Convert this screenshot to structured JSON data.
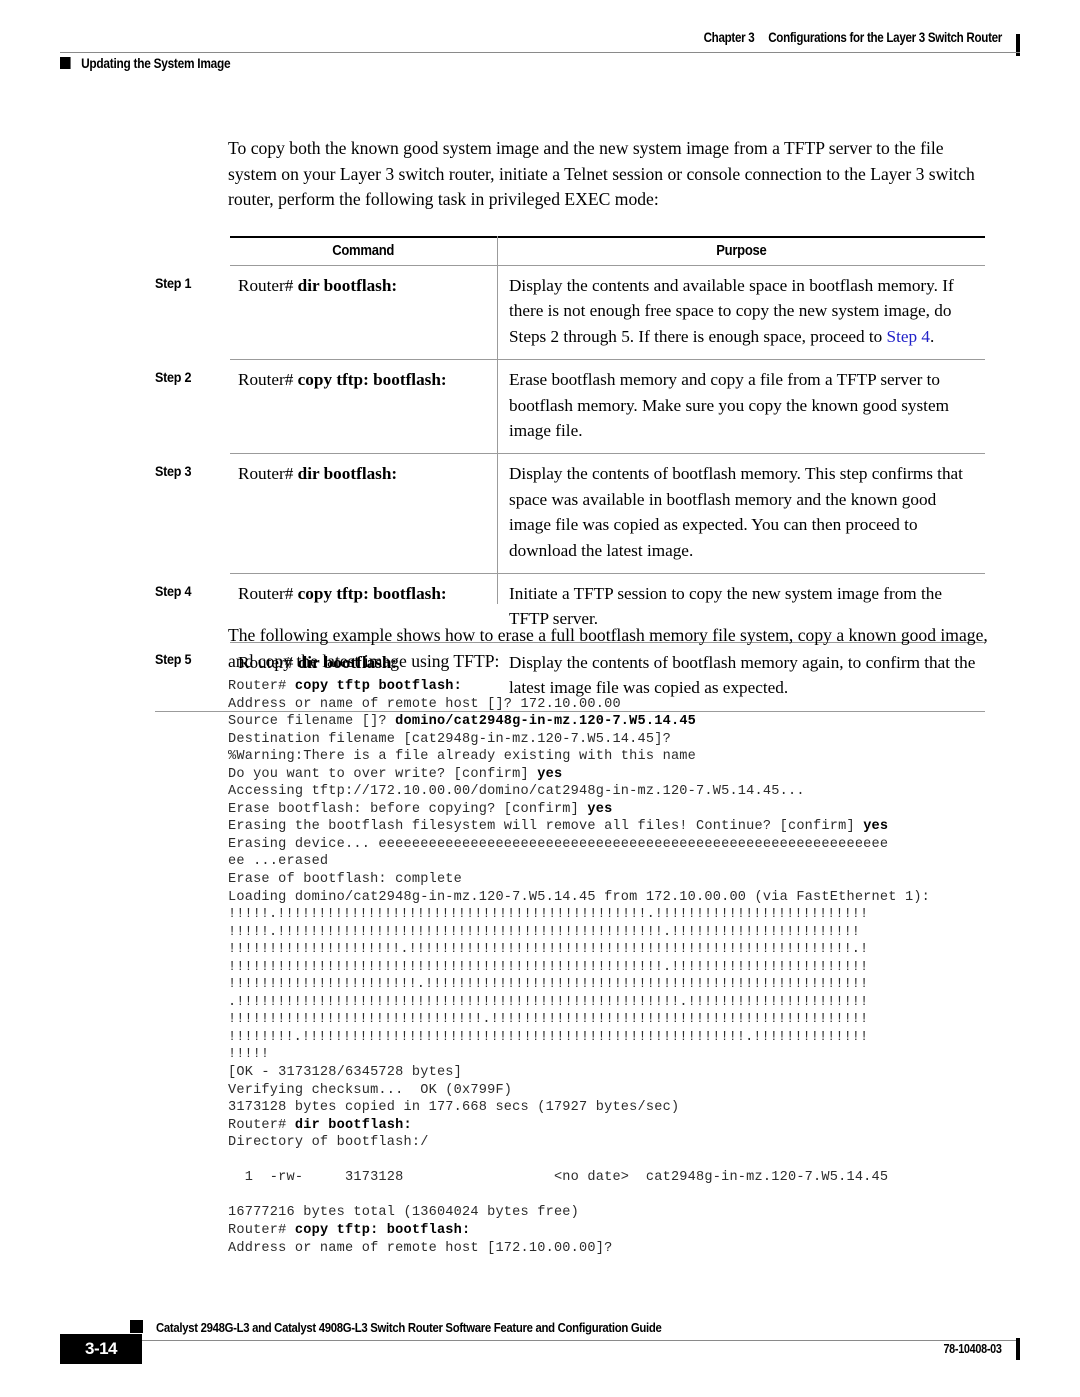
{
  "header": {
    "chapter": "Chapter 3",
    "chapter_title": "Configurations for the Layer 3 Switch Router",
    "section_title": "Updating the System Image"
  },
  "intro_paragraph": "To copy both the known good system image and the new system image from a TFTP server to the file system on your Layer 3 switch router, initiate a Telnet session or console connection to the Layer 3 switch router, perform the following task in privileged EXEC mode:",
  "table": {
    "headers": {
      "step": "",
      "command": "Command",
      "purpose": "Purpose"
    },
    "rows": [
      {
        "step": "Step 1",
        "command_prefix": "Router# ",
        "command_bold": "dir bootflash:",
        "purpose_pre": "Display the contents and available space in bootflash memory. If there is not enough free space to copy the new system image, do Steps 2 through 5. If there is enough space, proceed to ",
        "purpose_link": "Step 4",
        "purpose_post": "."
      },
      {
        "step": "Step 2",
        "command_prefix": "Router# ",
        "command_bold": "copy tftp: bootflash:",
        "purpose_pre": "Erase bootflash memory and copy a file from a TFTP server to bootflash memory. Make sure you copy the known good system image file.",
        "purpose_link": "",
        "purpose_post": ""
      },
      {
        "step": "Step 3",
        "command_prefix": "Router# ",
        "command_bold": "dir bootflash:",
        "purpose_pre": "Display the contents of bootflash memory. This step confirms that space was available in bootflash memory and the known good image file was copied as expected. You can then proceed to download the latest image.",
        "purpose_link": "",
        "purpose_post": ""
      },
      {
        "step": "Step 4",
        "command_prefix": "Router# ",
        "command_bold": "copy tftp: bootflash:",
        "purpose_pre": "Initiate a TFTP session to copy the new system image from the TFTP server.",
        "purpose_link": "",
        "purpose_post": ""
      },
      {
        "step": "Step 5",
        "command_prefix": "Router# ",
        "command_bold": "dir bootflash:",
        "purpose_pre": "Display the contents of bootflash memory again, to confirm that the latest image file was copied as expected.",
        "purpose_link": "",
        "purpose_post": ""
      }
    ]
  },
  "example_paragraph": "The following example shows how to erase a full bootflash memory file system, copy a known good image, and copy the latest image using TFTP:",
  "code": {
    "lines": [
      {
        "plain": "Router# ",
        "bold": "copy tftp bootflash:",
        "tail": ""
      },
      {
        "plain": "Address or name of remote host []? 172.10.00.00",
        "bold": "",
        "tail": ""
      },
      {
        "plain": "Source filename []? ",
        "bold": "domino/cat2948g-in-mz.120-7.W5.14.45",
        "tail": ""
      },
      {
        "plain": "Destination filename [cat2948g-in-mz.120-7.W5.14.45]?",
        "bold": "",
        "tail": ""
      },
      {
        "plain": "%Warning:There is a file already existing with this name",
        "bold": "",
        "tail": ""
      },
      {
        "plain": "Do you want to over write? [confirm] ",
        "bold": "yes",
        "tail": ""
      },
      {
        "plain": "Accessing tftp://172.10.00.00/domino/cat2948g-in-mz.120-7.W5.14.45...",
        "bold": "",
        "tail": ""
      },
      {
        "plain": "Erase bootflash: before copying? [confirm] ",
        "bold": "yes",
        "tail": ""
      },
      {
        "plain": "Erasing the bootflash filesystem will remove all files! Continue? [confirm] ",
        "bold": "yes",
        "tail": ""
      },
      {
        "plain": "Erasing device... eeeeeeeeeeeeeeeeeeeeeeeeeeeeeeeeeeeeeeeeeeeeeeeeeeeeeeeeeeeee",
        "bold": "",
        "tail": ""
      },
      {
        "plain": "ee ...erased",
        "bold": "",
        "tail": ""
      },
      {
        "plain": "Erase of bootflash: complete",
        "bold": "",
        "tail": ""
      },
      {
        "plain": "Loading domino/cat2948g-in-mz.120-7.W5.14.45 from 172.10.00.00 (via FastEthernet 1):",
        "bold": "",
        "tail": ""
      },
      {
        "plain": "!!!!!.!!!!!!!!!!!!!!!!!!!!!!!!!!!!!!!!!!!!!!!!!!!!!.!!!!!!!!!!!!!!!!!!!!!!!!!!",
        "bold": "",
        "tail": ""
      },
      {
        "plain": "!!!!!.!!!!!!!!!!!!!!!!!!!!!!!!!!!!!!!!!!!!!!!!!!!!!!!.!!!!!!!!!!!!!!!!!!!!!!!",
        "bold": "",
        "tail": ""
      },
      {
        "plain": "!!!!!!!!!!!!!!!!!!!!!.!!!!!!!!!!!!!!!!!!!!!!!!!!!!!!!!!!!!!!!!!!!!!!!!!!!!!!.!",
        "bold": "",
        "tail": ""
      },
      {
        "plain": "!!!!!!!!!!!!!!!!!!!!!!!!!!!!!!!!!!!!!!!!!!!!!!!!!!!!!.!!!!!!!!!!!!!!!!!!!!!!!!",
        "bold": "",
        "tail": ""
      },
      {
        "plain": "!!!!!!!!!!!!!!!!!!!!!!!.!!!!!!!!!!!!!!!!!!!!!!!!!!!!!!!!!!!!!!!!!!!!!!!!!!!!!!",
        "bold": "",
        "tail": ""
      },
      {
        "plain": ".!!!!!!!!!!!!!!!!!!!!!!!!!!!!!!!!!!!!!!!!!!!!!!!!!!!!!!.!!!!!!!!!!!!!!!!!!!!!!",
        "bold": "",
        "tail": ""
      },
      {
        "plain": "!!!!!!!!!!!!!!!!!!!!!!!!!!!!!!!.!!!!!!!!!!!!!!!!!!!!!!!!!!!!!!!!!!!!!!!!!!!!!!",
        "bold": "",
        "tail": ""
      },
      {
        "plain": "!!!!!!!!.!!!!!!!!!!!!!!!!!!!!!!!!!!!!!!!!!!!!!!!!!!!!!!!!!!!!!!.!!!!!!!!!!!!!!",
        "bold": "",
        "tail": ""
      },
      {
        "plain": "!!!!!",
        "bold": "",
        "tail": ""
      },
      {
        "plain": "[OK - 3173128/6345728 bytes]",
        "bold": "",
        "tail": ""
      },
      {
        "plain": "Verifying checksum...  OK (0x799F)",
        "bold": "",
        "tail": ""
      },
      {
        "plain": "3173128 bytes copied in 177.668 secs (17927 bytes/sec)",
        "bold": "",
        "tail": ""
      },
      {
        "plain": "Router# ",
        "bold": "dir bootflash:",
        "tail": ""
      },
      {
        "plain": "Directory of bootflash:/",
        "bold": "",
        "tail": ""
      },
      {
        "plain": "",
        "bold": "",
        "tail": ""
      },
      {
        "plain": "  1  -rw-     3173128                  <no date>  cat2948g-in-mz.120-7.W5.14.45",
        "bold": "",
        "tail": ""
      },
      {
        "plain": "",
        "bold": "",
        "tail": ""
      },
      {
        "plain": "16777216 bytes total (13604024 bytes free)",
        "bold": "",
        "tail": ""
      },
      {
        "plain": "Router# ",
        "bold": "copy tftp: bootflash:",
        "tail": ""
      },
      {
        "plain": "Address or name of remote host [172.10.00.00]?",
        "bold": "",
        "tail": ""
      }
    ]
  },
  "footer": {
    "title": "Catalyst 2948G-L3 and Catalyst 4908G-L3 Switch Router Software Feature and Configuration Guide",
    "page_number": "3-14",
    "doc_number": "78-10408-03"
  }
}
